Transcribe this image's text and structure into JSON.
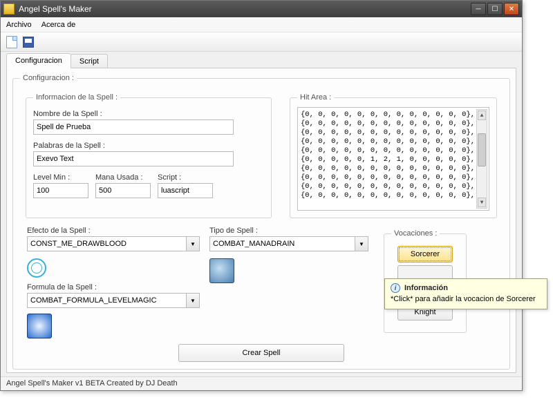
{
  "titlebar": {
    "title": "Angel Spell's Maker"
  },
  "menu": {
    "archivo": "Archivo",
    "acerca": "Acerca de"
  },
  "tabs": {
    "config": "Configuracion",
    "script": "Script"
  },
  "groups": {
    "config": "Configuracion :",
    "info": "Informacion de la Spell :",
    "hit": "Hit Area :",
    "voc": "Vocaciones :"
  },
  "info": {
    "name_label": "Nombre de la Spell :",
    "name_value": "Spell de Prueba",
    "words_label": "Palabras de la Spell :",
    "words_value": "Exevo Text",
    "level_label": "Level Min :",
    "level_value": "100",
    "mana_label": "Mana Usada :",
    "mana_value": "500",
    "script_label": "Script :",
    "script_value": "luascript"
  },
  "hit_lines": [
    "{0, 0, 0, 0, 0, 0, 0, 0, 0, 0, 0, 0, 0},",
    "{0, 0, 0, 0, 0, 0, 0, 0, 0, 0, 0, 0, 0},",
    "{0, 0, 0, 0, 0, 0, 0, 0, 0, 0, 0, 0, 0},",
    "{0, 0, 0, 0, 0, 0, 0, 0, 0, 0, 0, 0, 0},",
    "{0, 0, 0, 0, 0, 0, 0, 0, 0, 0, 0, 0, 0},",
    "{0, 0, 0, 0, 0, 1, 2, 1, 0, 0, 0, 0, 0},",
    "{0, 0, 0, 0, 0, 0, 0, 0, 0, 0, 0, 0, 0},",
    "{0, 0, 0, 0, 0, 0, 0, 0, 0, 0, 0, 0, 0},",
    "{0, 0, 0, 0, 0, 0, 0, 0, 0, 0, 0, 0, 0},",
    "{0, 0, 0, 0, 0, 0, 0, 0, 0, 0, 0, 0, 0},"
  ],
  "effect": {
    "label": "Efecto de la Spell :",
    "value": "CONST_ME_DRAWBLOOD"
  },
  "type": {
    "label": "Tipo de Spell :",
    "value": "COMBAT_MANADRAIN"
  },
  "formula": {
    "label": "Formula de la Spell :",
    "value": "COMBAT_FORMULA_LEVELMAGIC"
  },
  "voc": {
    "sorcerer": "Sorcerer",
    "knight": "Knight"
  },
  "create_label": "Crear Spell",
  "status": "Angel Spell's Maker v1 BETA Created by DJ Death",
  "tooltip": {
    "title": "Información",
    "body": "*Click* para añadir la vocacion de Sorcerer"
  }
}
